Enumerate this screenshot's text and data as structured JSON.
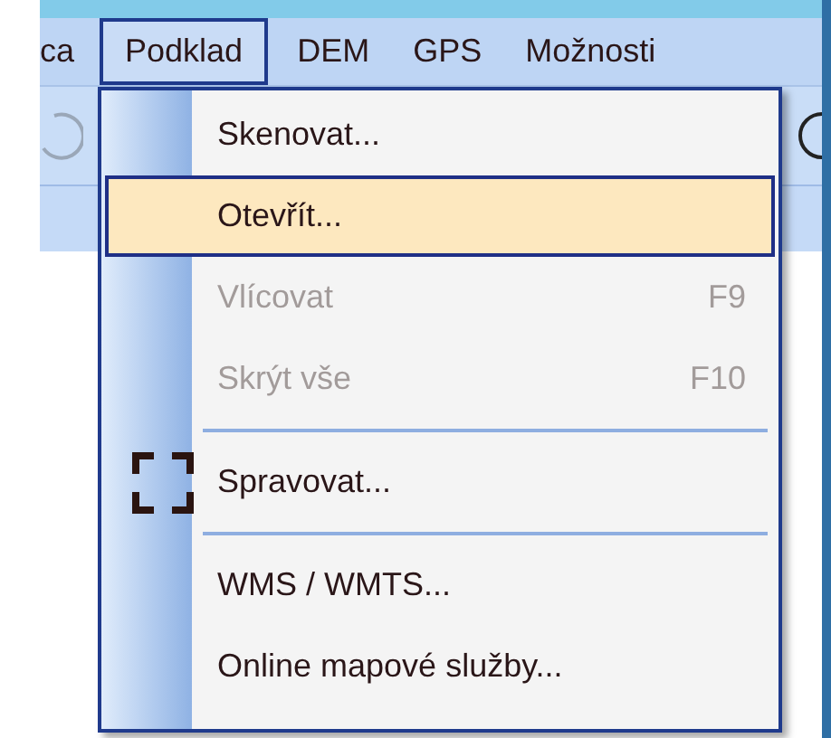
{
  "menubar": [
    {
      "label": "ca",
      "selected": false
    },
    {
      "label": "Podklad",
      "selected": true
    },
    {
      "label": "DEM",
      "selected": false
    },
    {
      "label": "GPS",
      "selected": false
    },
    {
      "label": "Možnosti",
      "selected": false
    }
  ],
  "menu": [
    {
      "kind": "item",
      "label": "Skenovat...",
      "selected": false,
      "disabled": false,
      "has_icon": false
    },
    {
      "kind": "item",
      "label": "Otevřít...",
      "selected": true,
      "disabled": false,
      "has_icon": false
    },
    {
      "kind": "item",
      "label": "Vlícovat",
      "shortcut": "F9",
      "selected": false,
      "disabled": true,
      "has_icon": false
    },
    {
      "kind": "item",
      "label": "Skrýt vše",
      "shortcut": "F10",
      "selected": false,
      "disabled": true,
      "has_icon": false
    },
    {
      "kind": "separator"
    },
    {
      "kind": "item",
      "label": "Spravovat...",
      "selected": false,
      "disabled": false,
      "has_icon": true
    },
    {
      "kind": "separator"
    },
    {
      "kind": "item",
      "label": "WMS / WMTS...",
      "selected": false,
      "disabled": false,
      "has_icon": false
    },
    {
      "kind": "item",
      "label": "Online mapové služby...",
      "selected": false,
      "disabled": false,
      "has_icon": false
    }
  ]
}
